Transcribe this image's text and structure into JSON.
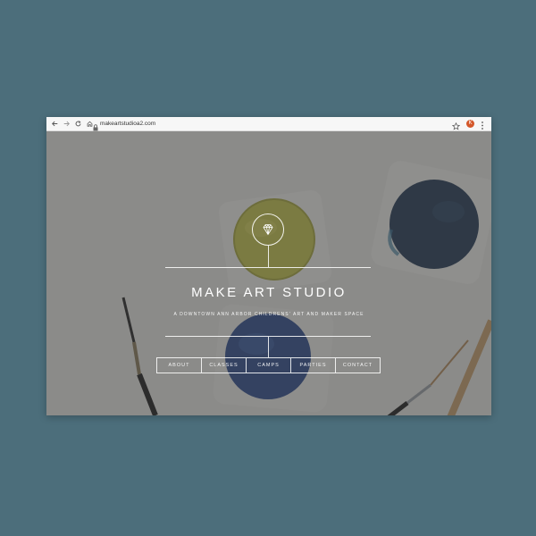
{
  "browser": {
    "url": "makeartstudioa2.com",
    "avatar_letter": "K",
    "icons": [
      "back-arrow-icon",
      "forward-arrow-icon",
      "reload-icon",
      "home-icon",
      "lock-icon",
      "star-icon",
      "kebab-menu-icon"
    ]
  },
  "hero": {
    "logo_icon": "diamond-icon",
    "title": "MAKE ART STUDIO",
    "tagline": "A DOWNTOWN ANN ARBOR CHILDRENS' ART AND MAKER SPACE"
  },
  "menu": {
    "items": [
      {
        "label": "ABOUT"
      },
      {
        "label": "CLASSES"
      },
      {
        "label": "CAMPS"
      },
      {
        "label": "PARTIES"
      },
      {
        "label": "CONTACT"
      }
    ]
  },
  "colors": {
    "page_background": "#4c6e7b",
    "avatar": "#d4572a",
    "paint_yellow": "#c9c84a",
    "paint_blue": "#2b4a8e",
    "paint_navy": "#1f3552"
  }
}
